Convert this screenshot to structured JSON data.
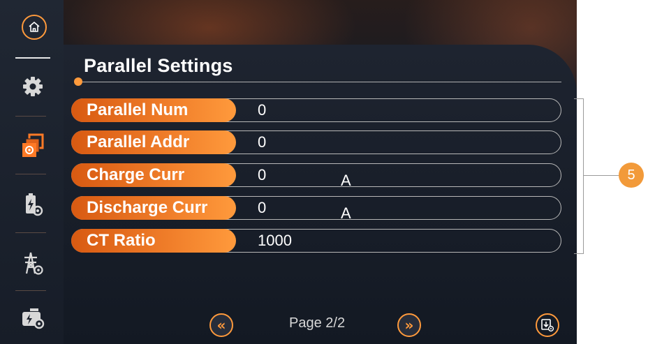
{
  "screen": {
    "title": "Parallel Settings",
    "rows": [
      {
        "label": "Parallel Num",
        "value": "0",
        "unit": ""
      },
      {
        "label": "Parallel Addr",
        "value": "0",
        "unit": ""
      },
      {
        "label": "Charge Curr",
        "value": "0",
        "unit": "A"
      },
      {
        "label": "Discharge Curr",
        "value": "0",
        "unit": "A"
      },
      {
        "label": "CT Ratio",
        "value": "1000",
        "unit": ""
      }
    ],
    "pagination": {
      "text": "Page 2/2",
      "prev_icon": "double-chevron-left-icon",
      "next_icon": "double-chevron-right-icon"
    }
  },
  "sidebar": {
    "icons": [
      "home-icon",
      "gear-icon",
      "parallel-settings-icon",
      "battery-settings-icon",
      "grid-settings-icon",
      "generator-settings-icon"
    ],
    "active": "parallel-settings-icon"
  },
  "annotation": {
    "callout": "5"
  },
  "colors": {
    "accent": "#ff9a3c",
    "pill_start": "#d85a12",
    "background": "#131923",
    "callout": "#f29a3a"
  }
}
